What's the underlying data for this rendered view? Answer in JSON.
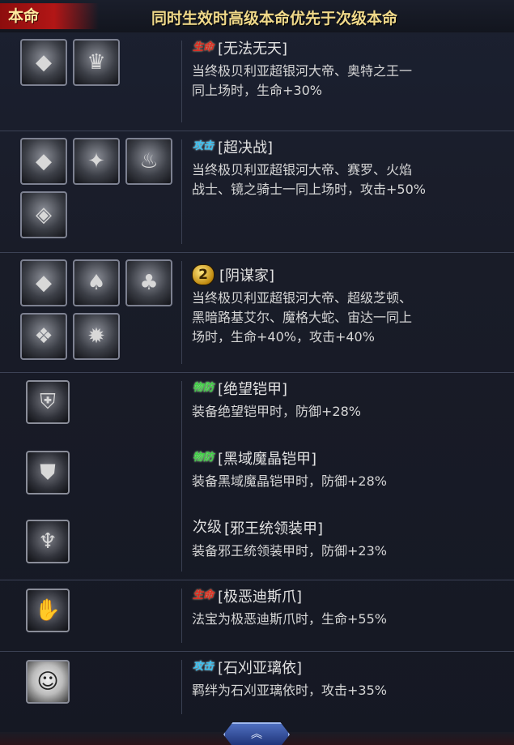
{
  "header": {
    "tag": "本命",
    "rule": "同时生效时高级本命优先于次级本命"
  },
  "rows": [
    {
      "badge": "生命",
      "badge_type": "life",
      "name": "[无法无天]",
      "desc": [
        "当终极贝利亚超银河大帝、奥特之王一",
        "同上场时，生命+30%"
      ],
      "icons": [
        "belial-portrait-icon",
        "ultraman-king-portrait-icon"
      ]
    },
    {
      "badge": "攻击",
      "badge_type": "atk",
      "name": "[超决战]",
      "desc": [
        "当终极贝利亚超银河大帝、赛罗、火焰",
        "战士、镜之骑士一同上场时，攻击+50%"
      ],
      "icons": [
        "belial-portrait-icon",
        "zero-portrait-icon",
        "glenfire-portrait-icon",
        "mirror-knight-portrait-icon"
      ]
    },
    {
      "badge": "2",
      "badge_type": "num",
      "name": "[阴谋家]",
      "desc": [
        "当终极贝利亚超银河大帝、超级芝顿、",
        "黑暗路基艾尔、魔格大蛇、宙达一同上",
        "场时，生命+40%，攻击+40%"
      ],
      "icons": [
        "belial-portrait-icon",
        "zetton-portrait-icon",
        "dark-lugiel-portrait-icon",
        "maga-orochi-portrait-icon",
        "juda-portrait-icon"
      ]
    },
    {
      "badge": "物防",
      "badge_type": "def",
      "name": "[绝望铠甲]",
      "desc": [
        "装备绝望铠甲时，防御+28%"
      ],
      "icons": [
        "despair-armor-icon"
      ]
    },
    {
      "badge": "物防",
      "badge_type": "def",
      "name": "[黑域魔晶铠甲]",
      "desc": [
        "装备黑域魔晶铠甲时，防御+28%"
      ],
      "icons": [
        "dark-crystal-armor-icon"
      ]
    },
    {
      "badge": "次级",
      "badge_type": "plain",
      "name": "[邪王统领装甲]",
      "desc": [
        "装备邪王统领装甲时，防御+23%"
      ],
      "icons": [
        "evil-king-armor-icon"
      ]
    },
    {
      "badge": "生命",
      "badge_type": "life",
      "name": "[极恶迪斯爪]",
      "desc": [
        "法宝为极恶迪斯爪时，生命+55%"
      ],
      "icons": [
        "evil-claw-icon"
      ]
    },
    {
      "badge": "攻击",
      "badge_type": "atk",
      "name": "[石刈亚璃依]",
      "desc": [
        "羁绊为石刈亚璃依时，攻击+35%"
      ],
      "icons": [
        "arie-ishikari-portrait-icon"
      ]
    }
  ],
  "colors": {
    "life": "#e0281f",
    "atk": "#3ac2f2",
    "def": "#3fd046",
    "title_tag_bg": "#b21616",
    "rule_text": "#f0d98a"
  },
  "collapse_glyph": "︽"
}
